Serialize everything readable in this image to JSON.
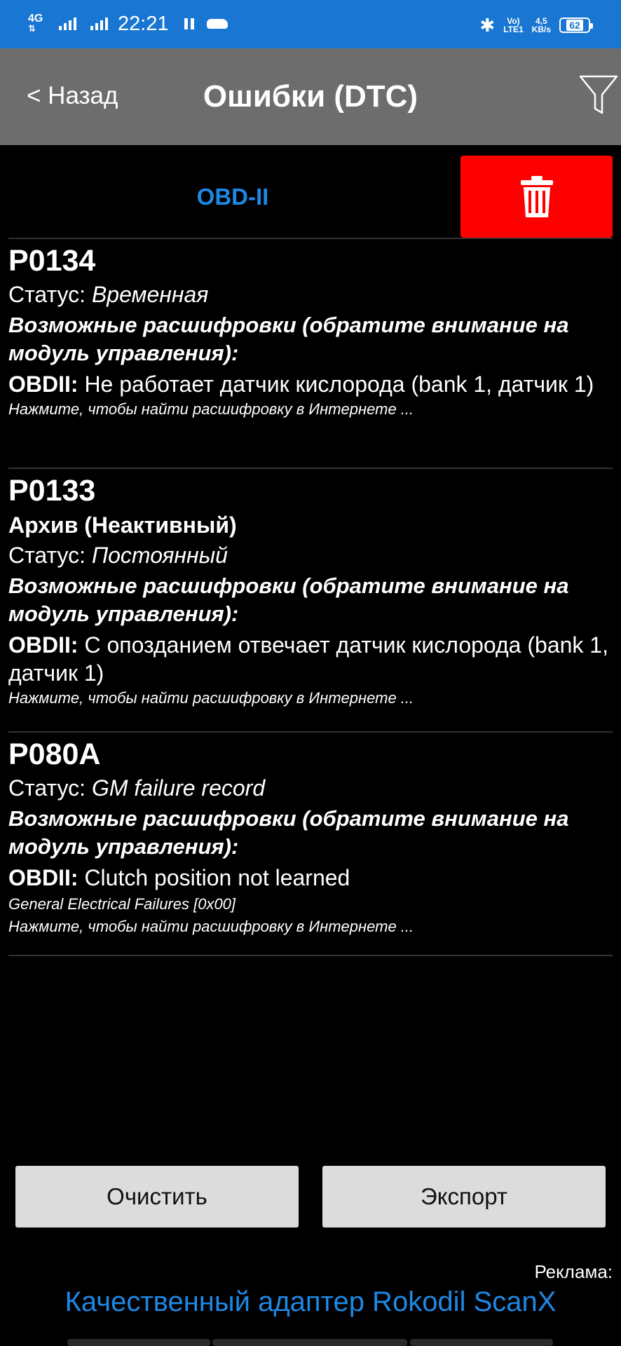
{
  "status_bar": {
    "network": "4G",
    "time": "22:21",
    "volte": "Vo)",
    "lte": "LTE1",
    "speed_value": "4,5",
    "speed_unit": "KB/s",
    "battery": "62"
  },
  "header": {
    "back_label": "< Назад",
    "title": "Ошибки (DTC)",
    "filter_icon": "filter-icon"
  },
  "toolbar": {
    "tab_label": "OBD-II",
    "delete_icon": "trash-icon",
    "delete_color": "#ff0000"
  },
  "entries": [
    {
      "code": "P0134",
      "status_prefix": "Статус: ",
      "status_value": "Временная",
      "possible": "Возможные расшифровки (обратите внимание на модуль управления):",
      "obd_prefix": "OBDII:",
      "obd_text": " Не работает датчик кислорода (bank 1, датчик 1)",
      "hint": "Нажмите, чтобы найти расшифровку в Интернете ..."
    },
    {
      "code": "P0133",
      "archive": "Архив (Неактивный)",
      "status_prefix": "Статус: ",
      "status_value": "Постоянный",
      "possible": "Возможные расшифровки (обратите внимание на модуль управления):",
      "obd_prefix": "OBDII:",
      "obd_text": " С опозданием отвечает датчик кислорода (bank 1, датчик 1)",
      "hint": "Нажмите, чтобы найти расшифровку в Интернете ..."
    },
    {
      "code": "P080A",
      "status_prefix": "Статус: ",
      "status_value": "GM failure record",
      "possible": "Возможные расшифровки (обратите внимание на модуль управления):",
      "obd_prefix": "OBDII:",
      "obd_text": " Clutch position not learned",
      "extra": "General Electrical Failures [0x00]",
      "hint": "Нажмите, чтобы найти расшифровку в Интернете ..."
    }
  ],
  "actions": {
    "clear_label": "Очистить",
    "export_label": "Экспорт"
  },
  "ad": {
    "label": "Реклама:",
    "link": "Качественный адаптер Rokodil ScanX",
    "link_color": "#1e88e5"
  }
}
